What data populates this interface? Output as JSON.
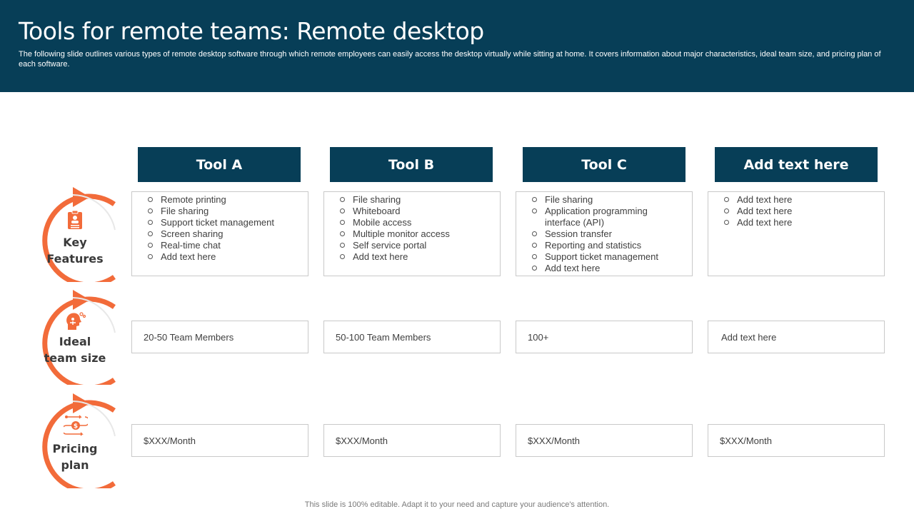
{
  "header": {
    "title": "Tools for remote teams: Remote desktop",
    "subtitle": "The following slide outlines various types of remote desktop software through which remote employees can easily access the desktop virtually while sitting at home. It covers information about major characteristics, ideal team size, and pricing plan of each software."
  },
  "columns": [
    {
      "label": "Tool A"
    },
    {
      "label": "Tool B"
    },
    {
      "label": "Tool C"
    },
    {
      "label": "Add text here"
    }
  ],
  "rows": {
    "key_features": {
      "label_line1": "Key",
      "label_line2": "Features",
      "icon": "clipboard-user-icon",
      "cells": [
        [
          "Remote printing",
          "File sharing",
          "Support ticket management",
          "Screen sharing",
          "Real-time chat",
          "Add text here"
        ],
        [
          "File sharing",
          "Whiteboard",
          "Mobile access",
          "Multiple monitor access",
          "Self service portal",
          "Add text here"
        ],
        [
          "File sharing",
          "Application programming",
          "interface (API)",
          "Session transfer",
          "Reporting and statistics",
          "Support ticket management",
          "Add text here"
        ],
        [
          "Add text here",
          "Add text here",
          "Add text here"
        ]
      ]
    },
    "ideal_team_size": {
      "label_line1": "Ideal",
      "label_line2": "team size",
      "icon": "team-head-icon",
      "cells": [
        "20-50 Team Members",
        "50-100 Team Members",
        "100+",
        "Add text here"
      ]
    },
    "pricing_plan": {
      "label_line1": "Pricing",
      "label_line2": "plan",
      "icon": "pricing-flow-icon",
      "cells": [
        "$XXX/Month",
        "$XXX/Month",
        "$XXX/Month",
        "$XXX/Month"
      ]
    }
  },
  "colors": {
    "header_bg": "#073e57",
    "accent_orange": "#f26b3a"
  },
  "footer": {
    "note": "This slide is 100% editable. Adapt it to your need and capture your audience's attention."
  }
}
